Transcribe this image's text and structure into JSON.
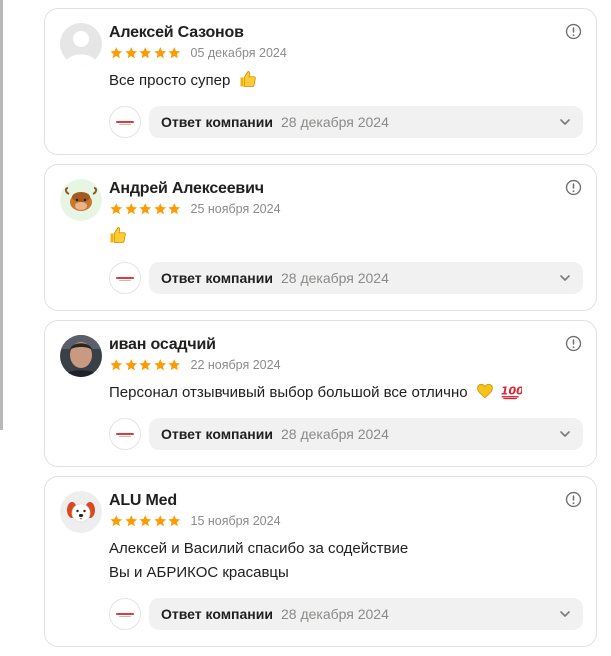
{
  "reviews": [
    {
      "author": "Алексей Сазонов",
      "date": "05 декабря 2024",
      "rating": 5,
      "text": [
        "Все просто супер"
      ],
      "emoji": "thumbs-up-icon",
      "avatar": "default-avatar",
      "reply_label": "Ответ компании",
      "reply_date": "28 декабря 2024"
    },
    {
      "author": "Андрей Алексеевич",
      "date": "25 ноября 2024",
      "rating": 5,
      "text": [
        ""
      ],
      "emoji": "thumbs-up-icon",
      "avatar": "ox-avatar",
      "reply_label": "Ответ компании",
      "reply_date": "28 декабря 2024"
    },
    {
      "author": "иван осадчий",
      "date": "22 ноября 2024",
      "rating": 5,
      "text": [
        "Персонал отзывчивый выбор большой все отлично"
      ],
      "emoji": "yellow-heart-and-hundred-icons",
      "avatar": "photo-avatar",
      "reply_label": "Ответ компании",
      "reply_date": "28 декабря 2024"
    },
    {
      "author": "ALU Med",
      "date": "15 ноября 2024",
      "rating": 5,
      "text": [
        "Алексей и Василий спасибо за содействие",
        "Вы и АБРИКОС красавцы"
      ],
      "emoji": "",
      "avatar": "dog-avatar",
      "reply_label": "Ответ компании",
      "reply_date": "28 декабря 2024"
    }
  ],
  "colors": {
    "star": "#fc9c04",
    "muted_text": "#8a8a88",
    "pill_bg": "#f1f1f1",
    "card_border": "#e1e1e1"
  }
}
